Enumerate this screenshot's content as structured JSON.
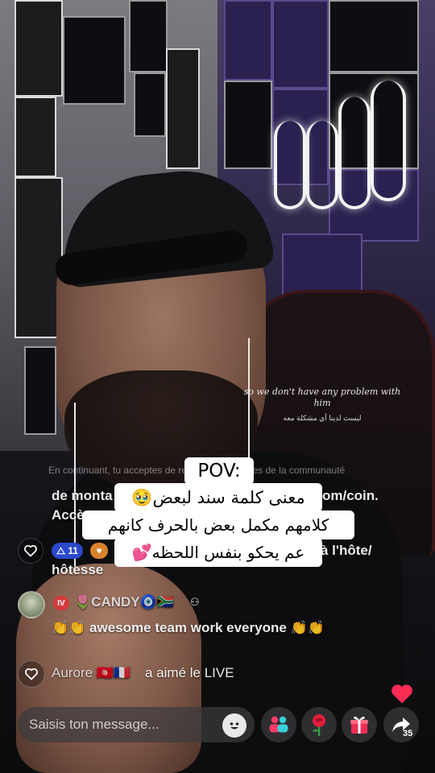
{
  "subtitles": {
    "english": "so we don't have any problem with him",
    "arabic": "ليست لدينا أي مشكلة معه"
  },
  "caption": {
    "pov": "POV:",
    "line1": "معنى كلمة سند لبعض🥹",
    "line2": "كلامهم مكمل بعض بالحرف كانهم",
    "line3": "عم يحكو بنفس اللحظه💕"
  },
  "live_chat": {
    "ghost_line": "En continuant, tu acceptes de respecter les règles de la communauté",
    "info_line1": "de monta",
    "info_line1_end": "om/coin.",
    "info_line2": "Accè",
    "host_row": {
      "level_badge": "11",
      "text_end": "à l'hôte/",
      "text_line2": "hôtesse"
    },
    "comment": {
      "level": "IV",
      "username": "🌷CANDY🧿🇿🇦",
      "message": "👏👏 awesome team work everyone 👏👏"
    },
    "like_event": {
      "username": "Aurore 🇹🇳🇫🇷",
      "action": "a aimé le LIVE"
    }
  },
  "bottom_bar": {
    "message_placeholder": "Saisis ton message...",
    "share_count": "35"
  },
  "icons": {
    "like": "heart-outline-icon",
    "emoji": "emoji-icon",
    "guests": "guests-icon",
    "rose": "rose-icon",
    "gift": "gift-icon",
    "share": "share-arrow-icon",
    "floating": "heart-filled-icon"
  },
  "colors": {
    "accent_pink": "#fe2c55",
    "guest_pink": "#ff3b6b",
    "badge_blue": "#2a49c9",
    "gift_red": "#f02d55"
  }
}
